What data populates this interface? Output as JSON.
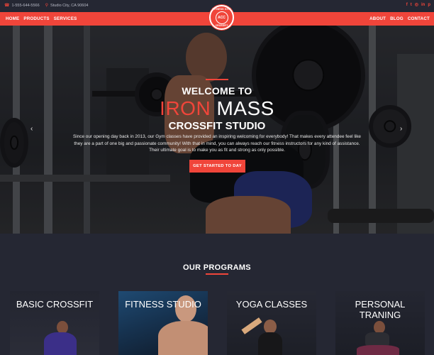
{
  "topbar": {
    "phone": "1-555-644-5566",
    "location": "Studio City, CA 90604",
    "social": [
      "f",
      "t",
      "◎",
      "in",
      "p"
    ]
  },
  "nav": {
    "left": [
      "HOME",
      "PRODUCTS",
      "SERVICES"
    ],
    "right": [
      "ABOUT",
      "BLOG",
      "CONTACT"
    ]
  },
  "logo": {
    "top_text": "FITNESS GYM",
    "center_text": "ACC",
    "bottom_text": "CROSSFIT"
  },
  "hero": {
    "welcome": "WELCOME TO",
    "brand_red": "IRON",
    "brand_white": "MASS",
    "tagline": "CROSSFIT STUDIO",
    "description": "Since our opening day back in 2013, our Gym classes have provided an inspiring welcoming for everybody! That makes every attendee feel like they are a part of one big and passionate community! With that in mind, you can always reach our fitness instructors for any kind of assistance. Their ultimate goal is to make you as fit and strong as only possible.",
    "cta": "GET STARTED TO DAY",
    "prev_arrow": "‹",
    "next_arrow": "›"
  },
  "programs": {
    "title": "OUR PROGRAMS",
    "cards": [
      {
        "title": "BASIC CROSSFIT"
      },
      {
        "title": "FITNESS STUDIO"
      },
      {
        "title": "YOGA CLASSES"
      },
      {
        "title": "PERSONAL TRANING"
      }
    ]
  },
  "colors": {
    "accent": "#f0453a",
    "background": "#252733"
  }
}
